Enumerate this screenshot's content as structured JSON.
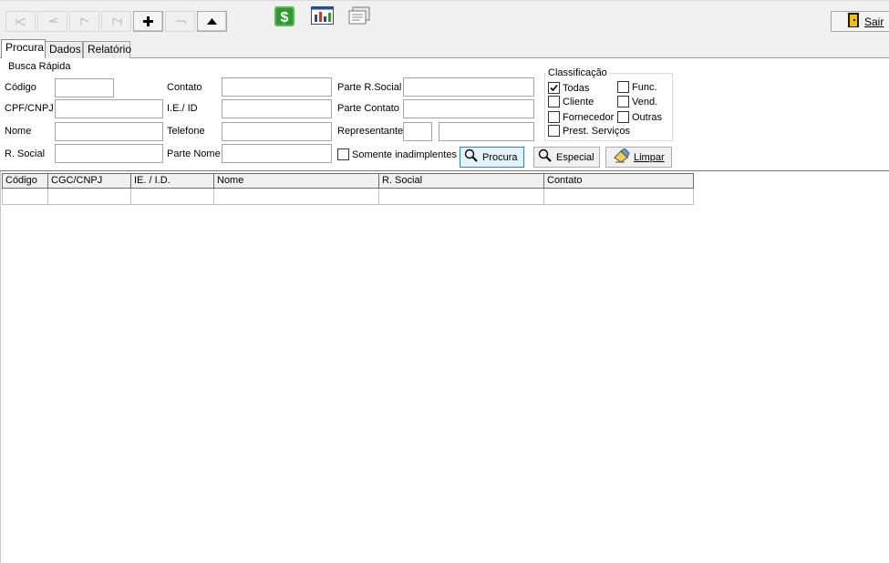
{
  "toolbar": {
    "nav_buttons": [
      "first-icon",
      "prior-icon",
      "next-icon",
      "last-icon",
      "insert-icon",
      "delete-icon",
      "up-arrow-icon"
    ],
    "icons": [
      "dollar-icon",
      "chart-icon",
      "report-icon"
    ],
    "sair_label": "Sair"
  },
  "tabs": [
    {
      "label": "Procura"
    },
    {
      "label": "Dados"
    },
    {
      "label": "Relatório"
    }
  ],
  "search": {
    "group_title": "Busca Rápida",
    "labels": {
      "codigo": "Código",
      "cpf_cnpj": "CPF/CNPJ",
      "nome": "Nome",
      "r_social": "R. Social",
      "contato": "Contato",
      "ie_id": "I.E./ ID",
      "telefone": "Telefone",
      "parte_nome": "Parte Nome",
      "parte_r_social": "Parte R.Social",
      "parte_contato": "Parte Contato",
      "representante": "Representante"
    },
    "values": {
      "codigo": "",
      "cpf_cnpj": "",
      "nome": "",
      "r_social": "",
      "contato": "",
      "ie_id": "",
      "telefone": "",
      "parte_nome": "",
      "parte_r_social": "",
      "parte_contato": "",
      "representante_code": "",
      "representante_name": ""
    },
    "somente_inadimplentes": "Somente inadimplentes"
  },
  "classificacao": {
    "title": "Classificação",
    "options": [
      {
        "label": "Todas",
        "checked": true
      },
      {
        "label": "Cliente",
        "checked": false
      },
      {
        "label": "Fornecedor",
        "checked": false
      },
      {
        "label": "Prest. Serviços",
        "checked": false
      },
      {
        "label": "Func.",
        "checked": false
      },
      {
        "label": "Vend.",
        "checked": false
      },
      {
        "label": "Outras",
        "checked": false
      }
    ]
  },
  "buttons": {
    "procura": "Procura",
    "especial": "Especial",
    "limpar": "Limpar"
  },
  "grid": {
    "columns": [
      "Código",
      "CGC/CNPJ",
      "IE. / I.D.",
      "Nome",
      "R. Social",
      "Contato"
    ],
    "rows": []
  },
  "colors": {
    "accent_focus": "#3c7fb1",
    "dollar_green": "#2e9a2e",
    "chart_blue": "#1f4f9b"
  }
}
